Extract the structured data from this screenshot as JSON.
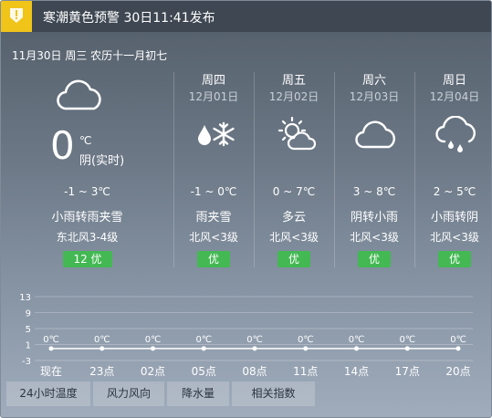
{
  "alert": {
    "text": "寒潮黄色预警 30日11:41发布",
    "color": "#f0c419"
  },
  "today": {
    "date_line": "11月30日 周三 农历十一月初七",
    "current_temp": "0",
    "unit": "℃",
    "current_condition": "阴(实时)",
    "icon": "cloud-icon",
    "temp_range": "-1 ~ 3℃",
    "condition": "小雨转雨夹雪",
    "wind": "东北风3-4级",
    "aqi": "12 优"
  },
  "forecast": [
    {
      "day": "周四",
      "date": "12月01日",
      "icon": "sleet-icon",
      "temp_range": "-1 ~ 0℃",
      "condition": "雨夹雪",
      "wind": "北风<3级",
      "aqi": "优"
    },
    {
      "day": "周五",
      "date": "12月02日",
      "icon": "partly-cloudy-icon",
      "temp_range": "0 ~ 7℃",
      "condition": "多云",
      "wind": "北风<3级",
      "aqi": "优"
    },
    {
      "day": "周六",
      "date": "12月03日",
      "icon": "cloud-icon",
      "temp_range": "3 ~ 8℃",
      "condition": "阴转小雨",
      "wind": "北风<3级",
      "aqi": "优"
    },
    {
      "day": "周日",
      "date": "12月04日",
      "icon": "light-rain-icon",
      "temp_range": "2 ~ 5℃",
      "condition": "小雨转阴",
      "wind": "北风<3级",
      "aqi": "优"
    }
  ],
  "colors": {
    "aqi_good": "#43b853",
    "alert_yellow": "#f0c419"
  },
  "chart_data": {
    "type": "line",
    "categories": [
      "现在",
      "23点",
      "02点",
      "05点",
      "08点",
      "11点",
      "14点",
      "17点",
      "20点"
    ],
    "series": [
      {
        "values": [
          0,
          0,
          0,
          0,
          0,
          0,
          0,
          0,
          0
        ]
      }
    ],
    "point_labels": [
      "0℃",
      "0℃",
      "0℃",
      "0℃",
      "0℃",
      "0℃",
      "0℃",
      "0℃",
      "0℃"
    ],
    "y_ticks": [
      "13",
      "9",
      "5",
      "1",
      "-3"
    ],
    "y_tick_values": [
      13,
      9,
      5,
      1,
      -3
    ],
    "ylim": [
      -3,
      13
    ],
    "grid": true
  },
  "tabs": [
    "24小时温度",
    "风力风向",
    "降水量",
    "相关指数"
  ]
}
